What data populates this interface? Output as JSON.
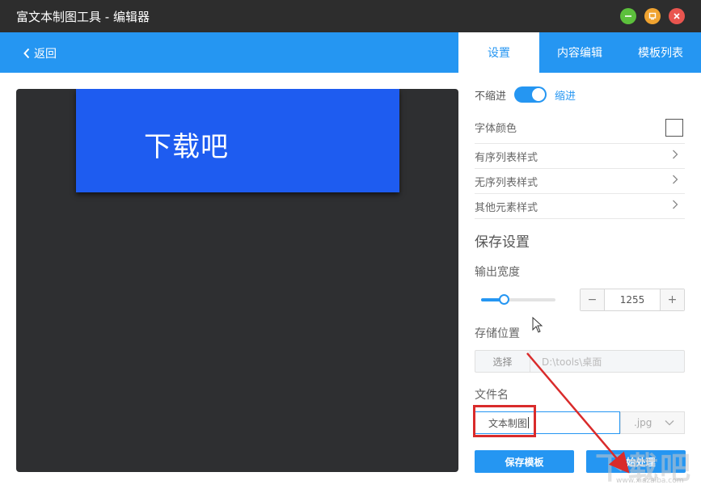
{
  "window": {
    "title": "富文本制图工具 - 编辑器"
  },
  "nav": {
    "back_label": "返回",
    "tabs": [
      {
        "label": "设置",
        "active": true
      },
      {
        "label": "内容编辑",
        "active": false
      },
      {
        "label": "模板列表",
        "active": false
      }
    ]
  },
  "preview": {
    "text": "下载吧"
  },
  "settings": {
    "indent_off_label": "不缩进",
    "indent_on_label": "缩进",
    "indent_enabled": true,
    "font_color_label": "字体颜色",
    "ordered_list_label": "有序列表样式",
    "unordered_list_label": "无序列表样式",
    "other_elements_label": "其他元素样式"
  },
  "save": {
    "section_title": "保存设置",
    "width_label": "输出宽度",
    "width_slider_fraction": 0.3,
    "width_minus": "−",
    "width_value": "1255",
    "width_plus": "+",
    "storage_label": "存储位置",
    "choose_label": "选择",
    "path_placeholder": "D:\\tools\\桌面",
    "filename_label": "文件名",
    "filename_value": "文本制图",
    "extension": ".jpg",
    "save_template_label": "保存模板",
    "start_label": "开始处理"
  },
  "watermark": {
    "big": "下载吧",
    "small": "www.xiazaiba.com"
  },
  "colors": {
    "accent": "#2596f2",
    "titlebar": "#2d2d2d",
    "preview_bg": "#2e2f31",
    "card": "#1e5cf0",
    "annotation_red": "#d92b2b"
  }
}
